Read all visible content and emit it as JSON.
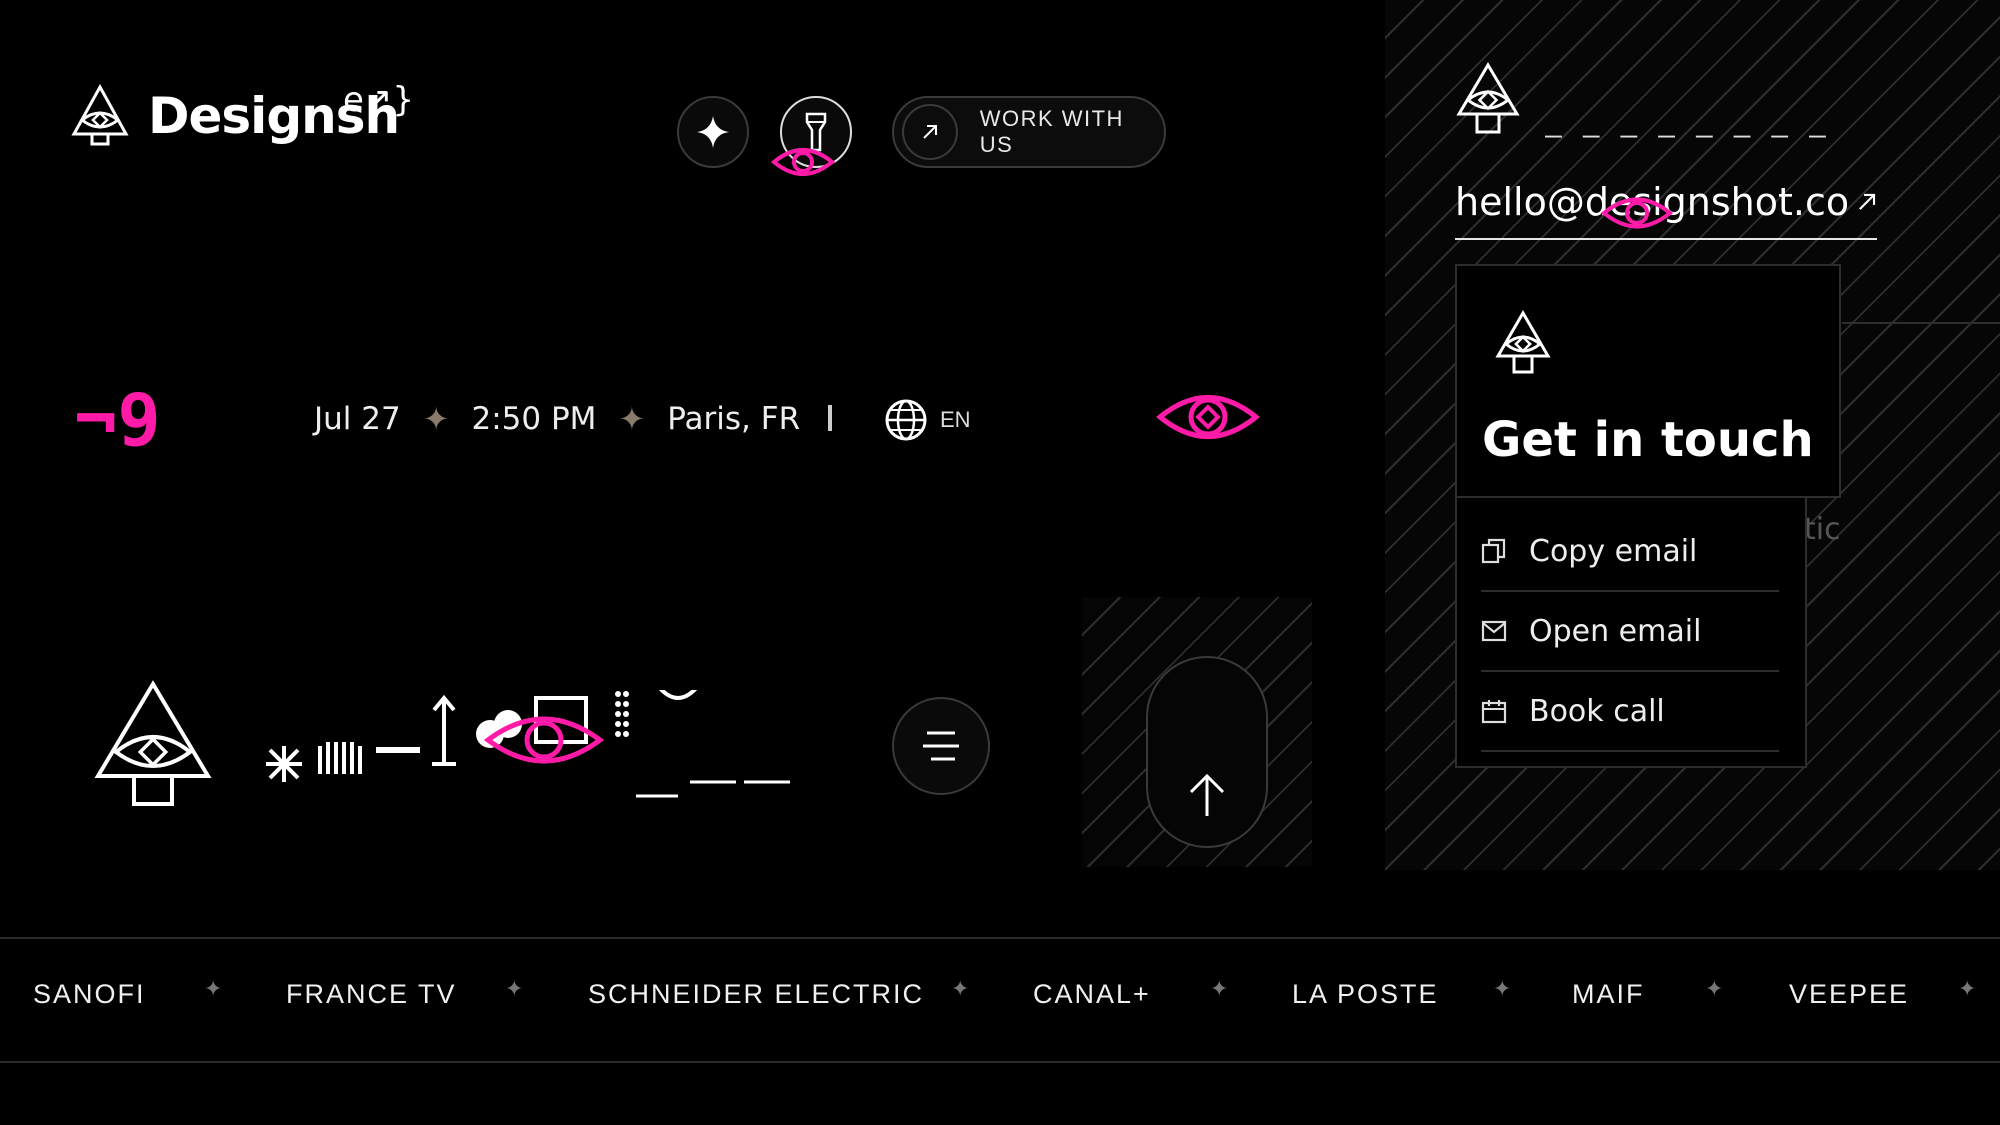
{
  "brand": {
    "name": "Designsh",
    "superscript": "e↗}"
  },
  "header": {
    "work_button_label": "WORK WITH US"
  },
  "info": {
    "date": "Jul 27",
    "separator": "✦",
    "time": "2:50 PM",
    "location": "Paris, FR",
    "language": "EN"
  },
  "decor": {
    "pink_glyph": "¬9",
    "dash_line": "— — — — — — — —",
    "partial_text": "tic"
  },
  "contact": {
    "email": "hello@designshot.co",
    "title": "Get in touch",
    "actions": [
      {
        "label": "Copy email",
        "icon": "copy-icon"
      },
      {
        "label": "Open email",
        "icon": "mail-icon"
      },
      {
        "label": "Book call",
        "icon": "calendar-icon"
      }
    ]
  },
  "clients": [
    "SANOFI",
    "FRANCE TV",
    "SCHNEIDER ELECTRIC",
    "CANAL+",
    "LA POSTE",
    "MAIF",
    "VEEPEE"
  ],
  "colors": {
    "accent": "#ff1aa8",
    "background": "#000000"
  }
}
